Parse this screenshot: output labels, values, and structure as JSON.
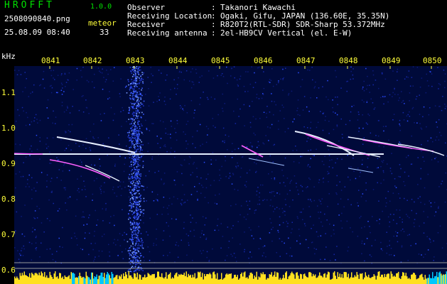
{
  "header": {
    "logo": "HROFFT",
    "version": "1.0.0",
    "filename": "2508090840.png",
    "datetime": "25.08.09 08:40",
    "meteor_label": "meteor",
    "meteor_count": "33"
  },
  "info": [
    {
      "label": "Observer",
      "value": "Takanori Kawachi"
    },
    {
      "label": "Receiving Location",
      "value": "Ogaki, Gifu, JAPAN (136.60E, 35.35N)"
    },
    {
      "label": "Receiver",
      "value": "R820T2(RTL-SDR) SDR-Sharp 53.372MHz"
    },
    {
      "label": "Receiving antenna",
      "value": "2el-HB9CV Vertical (el. E-W)"
    }
  ],
  "separator": ":",
  "colors": {
    "background": "#000000",
    "plot_background": "#000a3a",
    "text_green": "#00e000",
    "text_yellow": "#ffff3a",
    "text_white": "#ffffff",
    "meteor_trail": "#d8e8ff",
    "baseline_trace": "#ffe020",
    "cyan_trace": "#00c8ff"
  },
  "chart_data": {
    "type": "heatmap",
    "ylabel": "kHz",
    "xlabels": [
      "0841",
      "0842",
      "0843",
      "0844",
      "0845",
      "0846",
      "0847",
      "0848",
      "0849",
      "0850"
    ],
    "yticks": [
      "1.1",
      "1.0",
      "0.9",
      "0.8",
      "0.7",
      "0.6"
    ],
    "carrier_khz": 0.92,
    "noise_band_minute": "0843"
  }
}
